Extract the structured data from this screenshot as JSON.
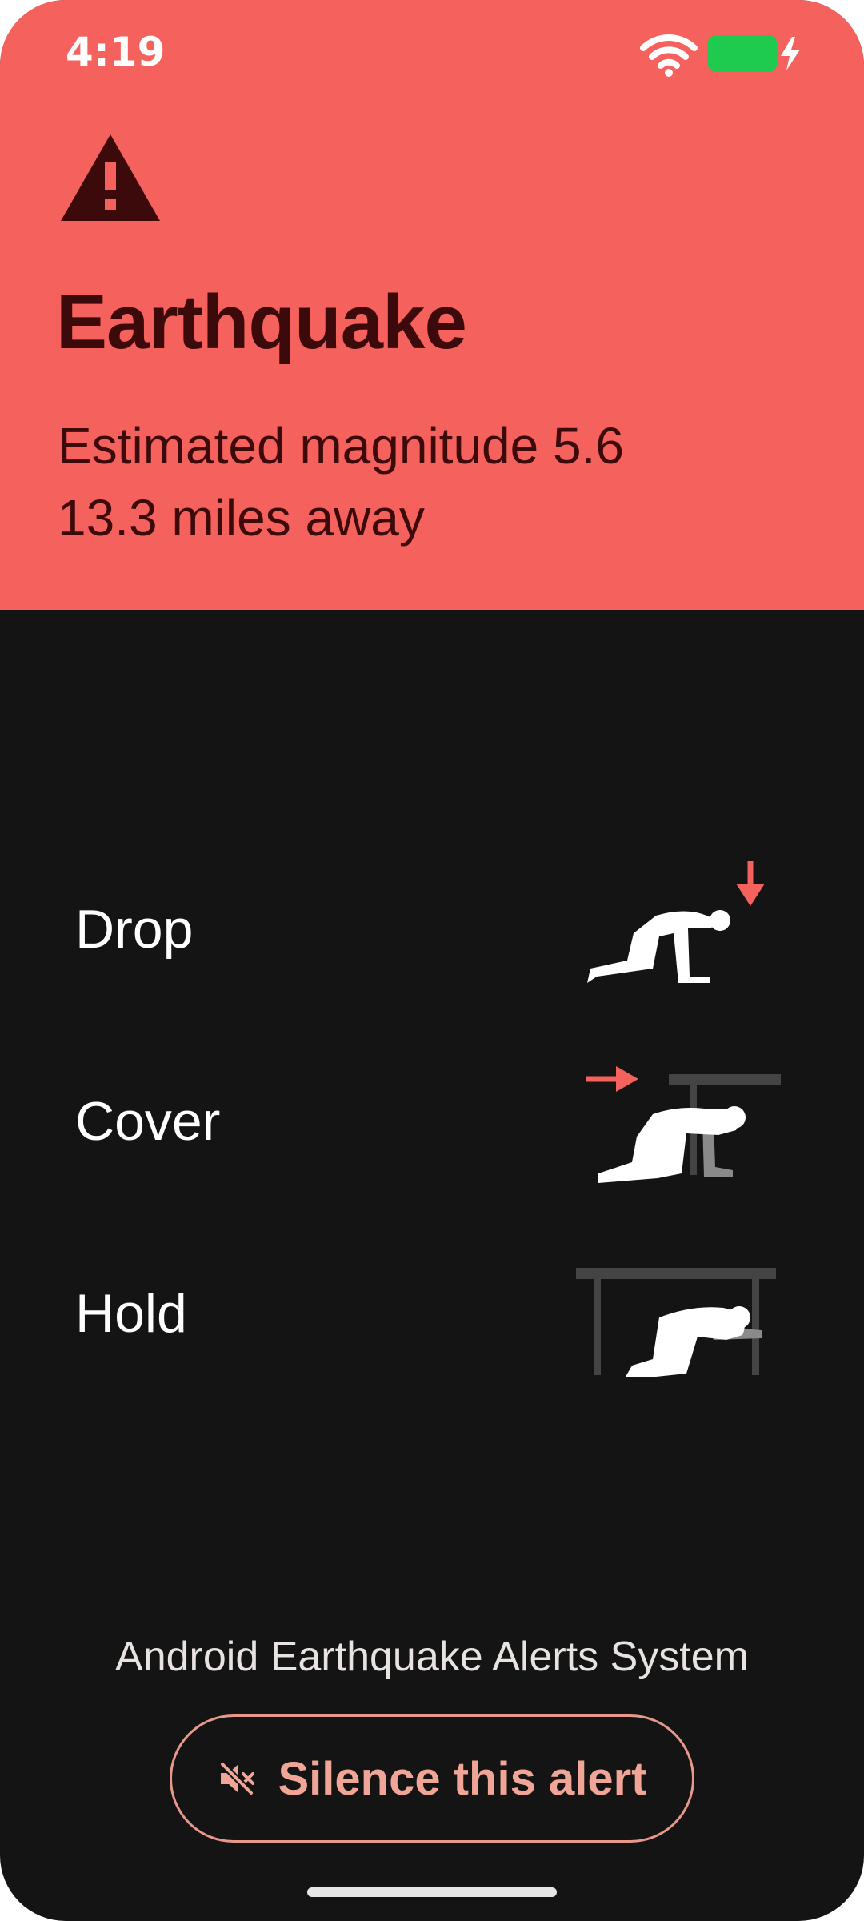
{
  "status_bar": {
    "time": "4:19",
    "wifi_icon": "wifi-icon",
    "battery_icon": "battery-charging-icon",
    "battery_color": "#1fcb4f"
  },
  "alert": {
    "icon": "warning-triangle-icon",
    "title": "Earthquake",
    "magnitude": "Estimated magnitude 5.6",
    "distance": "13.3 miles away",
    "background_color": "#f5625d",
    "text_color": "#3c0a0a"
  },
  "steps": [
    {
      "label": "Drop",
      "illustration": "drop-illustration"
    },
    {
      "label": "Cover",
      "illustration": "cover-illustration"
    },
    {
      "label": "Hold",
      "illustration": "hold-illustration"
    }
  ],
  "footer": {
    "system_name": "Android Earthquake Alerts System",
    "silence_button_label": "Silence this alert",
    "silence_icon": "volume-off-icon",
    "accent_color": "#f1a597"
  }
}
